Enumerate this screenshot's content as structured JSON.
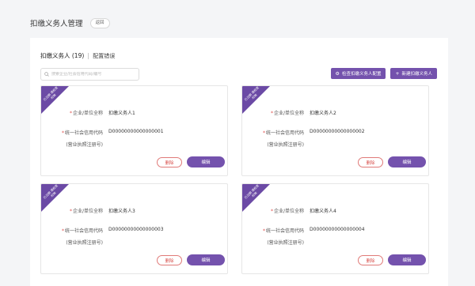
{
  "header": {
    "title": "扣缴义务人管理",
    "back_label": "返回"
  },
  "tabs": {
    "active_label": "扣缴义务人 (19)",
    "other_label": "配置错误"
  },
  "search": {
    "placeholder": "搜索企业/社会信用代码/编号"
  },
  "toolbar": {
    "check_label": "检查扣缴义务人配置",
    "new_label": "新建扣缴义务人"
  },
  "labels": {
    "name": "企业/单位全称",
    "credit_code": "统一社会信用代码",
    "credit_note": "(营业执照注册号)",
    "ribbon": "已过期 请检查时效",
    "delete": "删除",
    "edit": "编辑"
  },
  "cards": [
    {
      "name": "扣缴义务人1",
      "code": "D00000000000000001"
    },
    {
      "name": "扣缴义务人2",
      "code": "D00000000000000002"
    },
    {
      "name": "扣缴义务人3",
      "code": "D00000000000000003"
    },
    {
      "name": "扣缴义务人4",
      "code": "D00000000000000004"
    }
  ],
  "colors": {
    "accent": "#7452ad",
    "ribbon": "#6b4aa5",
    "danger": "#d9534f",
    "required_star": "#e0514e"
  }
}
